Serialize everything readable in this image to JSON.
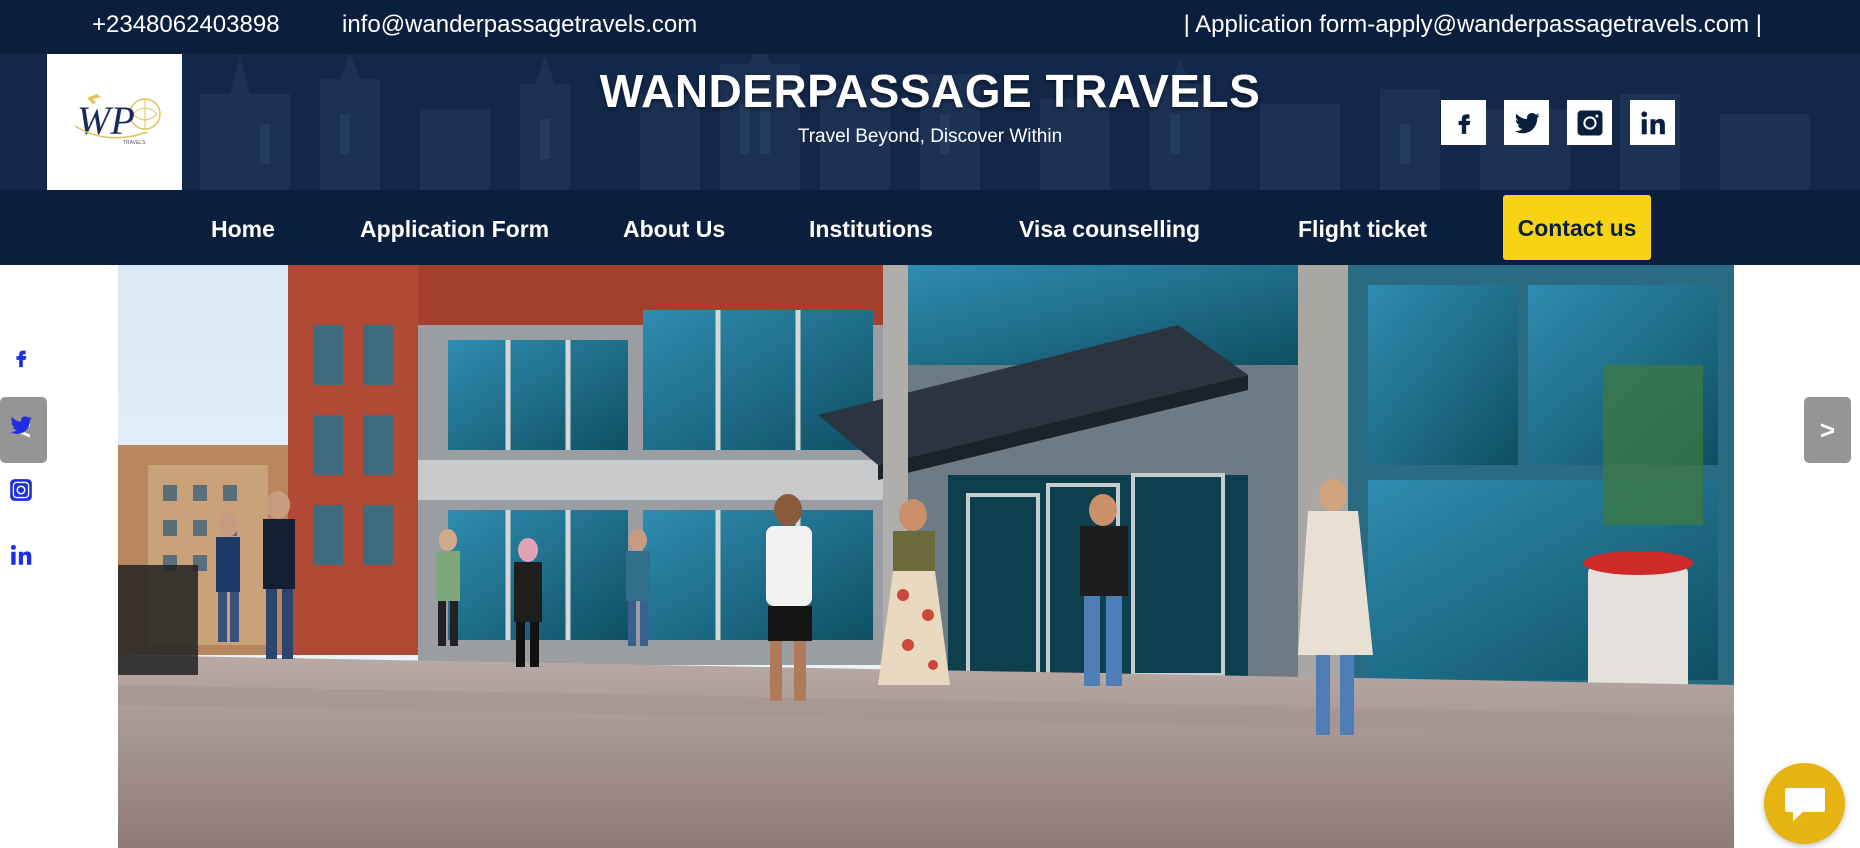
{
  "topbar": {
    "phone": "+2348062403898",
    "email": "info@wanderpassagetravels.com",
    "application": "| Application form-apply@wanderpassagetravels.com |"
  },
  "header": {
    "title": "WANDERPASSAGE TRAVELS",
    "tagline": "Travel Beyond, Discover Within",
    "logo_text": "WP",
    "logo_subtext": "TRAVELS",
    "social": [
      "facebook-icon",
      "twitter-icon",
      "instagram-icon",
      "linkedin-icon"
    ]
  },
  "nav": {
    "home": "Home",
    "application": "Application Form",
    "about": "About Us",
    "institutions": "Institutions",
    "visa": "Visa counselling",
    "flight": "Flight ticket",
    "contact": "Contact us"
  },
  "slider": {
    "prev": "<",
    "next": ">"
  },
  "side_social": [
    "facebook-icon",
    "twitter-icon",
    "instagram-icon",
    "linkedin-icon"
  ],
  "colors": {
    "navy": "#0a1f3d",
    "accent_yellow": "#f7d314",
    "chat_gold": "#e6b412",
    "side_icon_blue": "#1f2ee6"
  }
}
